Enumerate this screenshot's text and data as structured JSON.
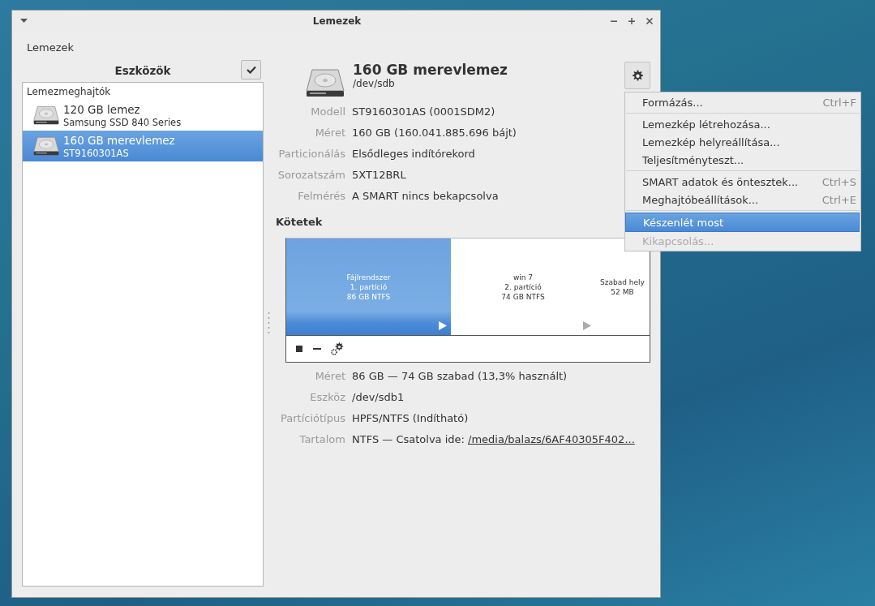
{
  "window": {
    "title": "Lemezek"
  },
  "header": "Lemezek",
  "sidebar": {
    "title": "Eszközök",
    "select_mode": false,
    "section": "Lemezmeghajtók",
    "items": [
      {
        "title": "120 GB lemez",
        "subtitle": "Samsung SSD 840 Series",
        "selected": false
      },
      {
        "title": "160 GB merevlemez",
        "subtitle": "ST9160301AS",
        "selected": true
      }
    ]
  },
  "disk": {
    "title": "160 GB merevlemez",
    "device": "/dev/sdb",
    "properties": [
      {
        "label": "Modell",
        "value": "ST9160301AS (0001SDM2)"
      },
      {
        "label": "Méret",
        "value": "160 GB (160.041.885.696 bájt)"
      },
      {
        "label": "Particionálás",
        "value": "Elsődleges indítórekord"
      },
      {
        "label": "Sorozatszám",
        "value": "5XT12BRL"
      },
      {
        "label": "Felmérés",
        "value": "A SMART nincs bekapcsolva"
      }
    ]
  },
  "volumes": {
    "title": "Kötetek",
    "partitions": [
      {
        "kind": "partition",
        "lines": [
          "Fájlrendszer",
          "1. partíció",
          "86 GB NTFS"
        ],
        "selected": true
      },
      {
        "kind": "partition",
        "lines": [
          "win 7",
          "2. partíció",
          "74 GB NTFS"
        ],
        "selected": false
      },
      {
        "kind": "free",
        "lines": [
          "Szabad hely",
          "52 MB"
        ],
        "selected": false
      }
    ],
    "properties": [
      {
        "label": "Méret",
        "value": "86 GB — 74 GB szabad (13,3% használt)"
      },
      {
        "label": "Eszköz",
        "value": "/dev/sdb1"
      },
      {
        "label": "Partíciótípus",
        "value": "HPFS/NTFS (Indítható)"
      },
      {
        "label": "Tartalom",
        "value": "NTFS — Csatolva ide: ",
        "link": "/media/balazs/6AF40305F402..."
      }
    ]
  },
  "menu": {
    "items": [
      {
        "kind": "item",
        "label": "Formázás...",
        "shortcut": "Ctrl+F",
        "selected": false,
        "disabled": false
      },
      {
        "kind": "separator"
      },
      {
        "kind": "item",
        "label": "Lemezkép létrehozása...",
        "selected": false,
        "disabled": false
      },
      {
        "kind": "item",
        "label": "Lemezkép helyreállítása...",
        "selected": false,
        "disabled": false
      },
      {
        "kind": "item",
        "label": "Teljesítményteszt...",
        "selected": false,
        "disabled": false
      },
      {
        "kind": "separator"
      },
      {
        "kind": "item",
        "label": "SMART adatok és öntesztek...",
        "shortcut": "Ctrl+S",
        "selected": false,
        "disabled": false
      },
      {
        "kind": "item",
        "label": "Meghajtóbeállítások...",
        "shortcut": "Ctrl+E",
        "selected": false,
        "disabled": false
      },
      {
        "kind": "separator"
      },
      {
        "kind": "item",
        "label": "Készenlét most",
        "selected": true,
        "disabled": false
      },
      {
        "kind": "item",
        "label": "Kikapcsolás...",
        "selected": false,
        "disabled": true
      }
    ]
  }
}
